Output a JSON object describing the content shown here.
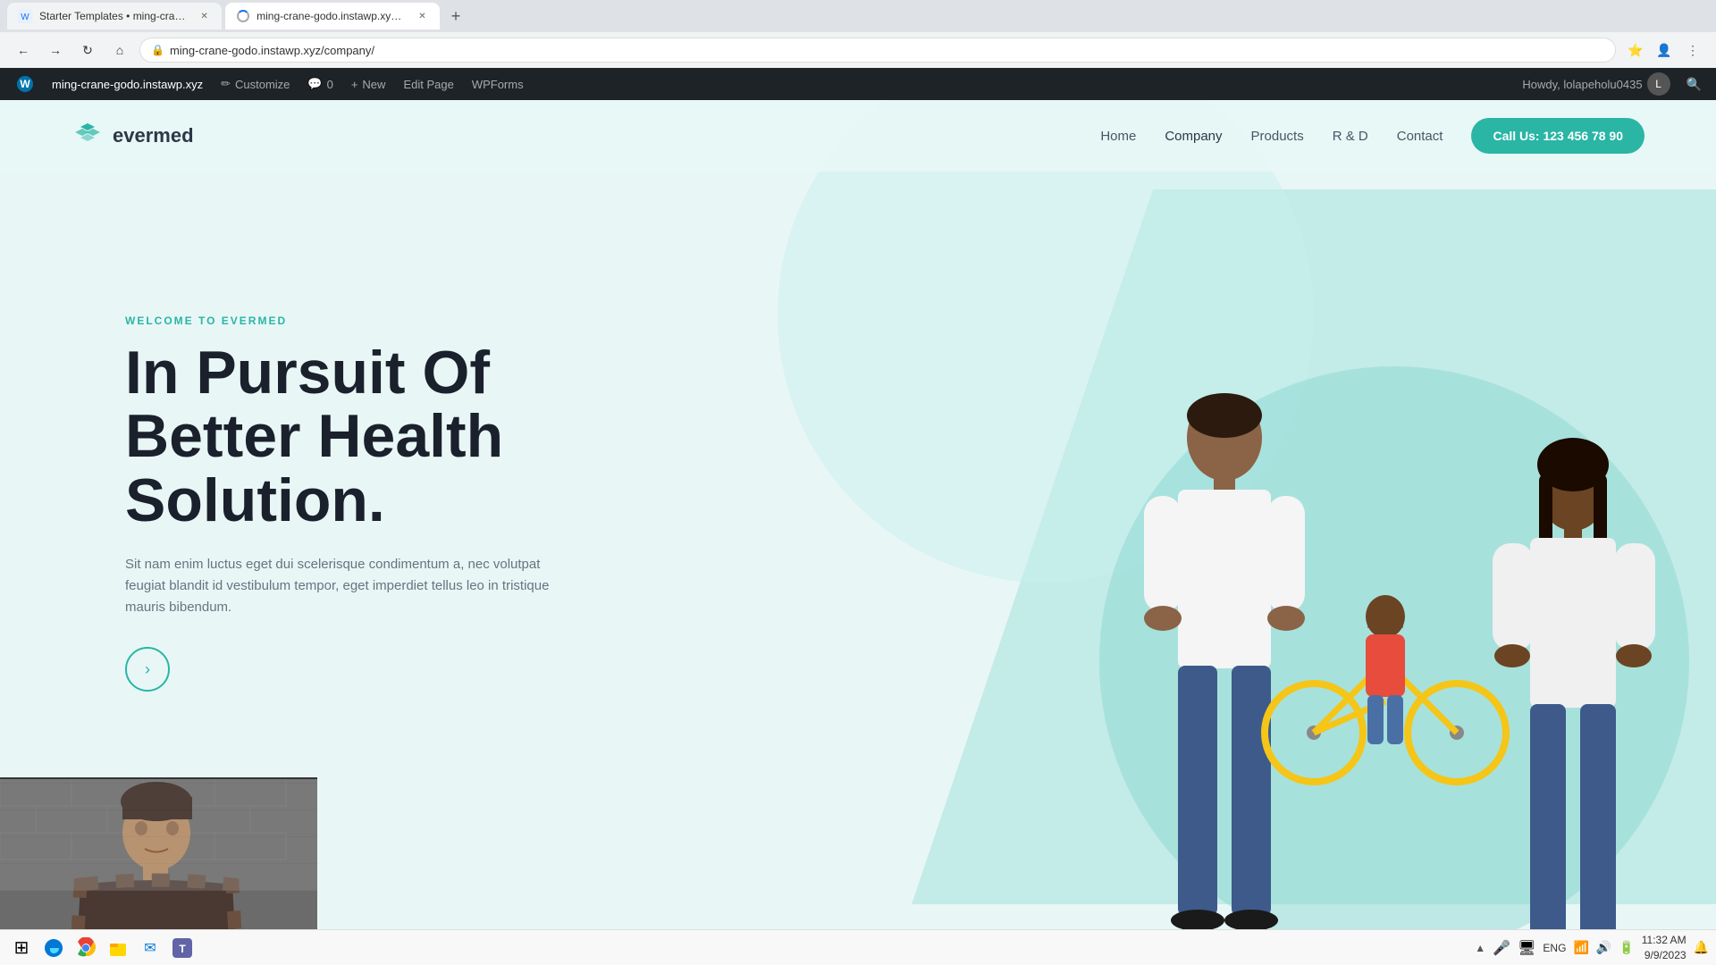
{
  "browser": {
    "tabs": [
      {
        "id": "tab1",
        "title": "Starter Templates • ming-crane-...",
        "favicon": "▶",
        "active": false,
        "loading": false
      },
      {
        "id": "tab2",
        "title": "ming-crane-godo.instawp.xyz/c...",
        "favicon": "🌐",
        "active": true,
        "loading": true
      }
    ],
    "new_tab_label": "+",
    "address": "ming-crane-godo.instawp.xyz/company/",
    "nav": {
      "back": "←",
      "forward": "→",
      "refresh": "↻",
      "home": "⌂"
    }
  },
  "wp_admin_bar": {
    "wp_logo": "W",
    "site_name": "ming-crane-godo.instawp.xyz",
    "customize": "Customize",
    "comments_count": "0",
    "new_label": "New",
    "edit_page": "Edit Page",
    "wp_forms": "WPForms",
    "howdy": "Howdy, lolapeholu0435",
    "search_icon": "🔍"
  },
  "site": {
    "logo_text": "evermed",
    "nav": {
      "items": [
        {
          "label": "Home",
          "active": false
        },
        {
          "label": "Company",
          "active": true
        },
        {
          "label": "Products",
          "active": false
        },
        {
          "label": "R & D",
          "active": false
        },
        {
          "label": "Contact",
          "active": false
        }
      ],
      "cta_button": "Call Us: 123 456 78 90"
    },
    "hero": {
      "tag": "WELCOME TO EVERMED",
      "title_line1": "In Pursuit Of",
      "title_line2": "Better Health",
      "title_line3": "Solution.",
      "description": "Sit nam enim luctus eget dui scelerisque condimentum a, nec volutpat feugiat blandit id vestibulum tempor, eget imperdiet tellus leo in tristique mauris bibendum.",
      "arrow": "→"
    }
  },
  "taskbar": {
    "icons": [
      {
        "name": "windows",
        "symbol": "⊞"
      },
      {
        "name": "edge",
        "symbol": "🔷"
      },
      {
        "name": "explorer",
        "symbol": "📁"
      },
      {
        "name": "chrome",
        "symbol": "⚙"
      },
      {
        "name": "outlook",
        "symbol": "📧"
      },
      {
        "name": "teams",
        "symbol": "💬"
      }
    ],
    "system": {
      "battery": "🔋",
      "wifi": "📶",
      "volume": "🔊",
      "language": "ENG",
      "time": "11:32 AM",
      "date": "9/9/2023"
    }
  },
  "colors": {
    "teal": "#2ab5a5",
    "light_bg": "#e8f7f6",
    "dark_text": "#1a202c",
    "gray_text": "#6b7280",
    "admin_bar_bg": "#1d2327",
    "admin_bar_text": "#a7aaad"
  }
}
